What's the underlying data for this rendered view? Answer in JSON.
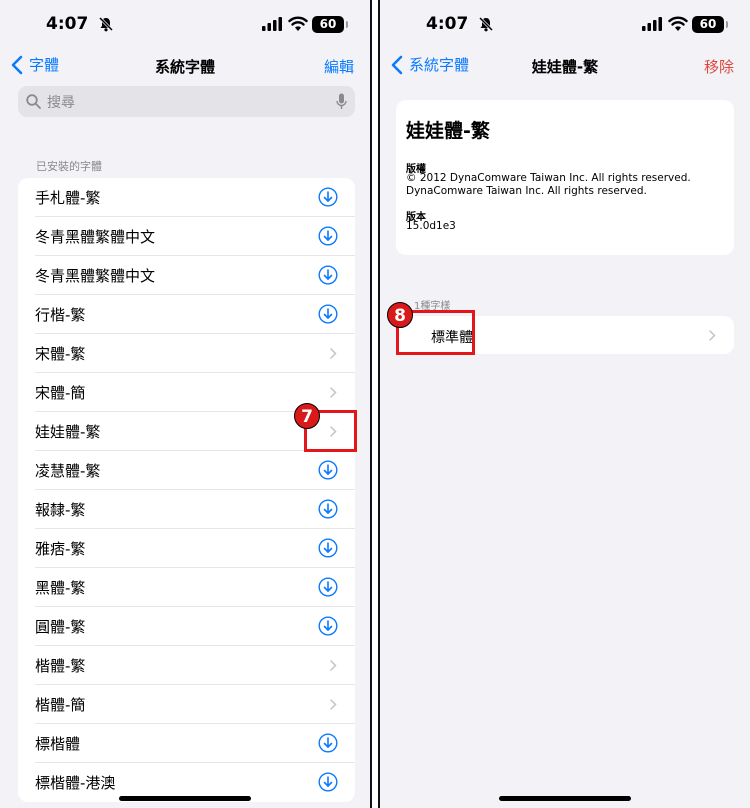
{
  "status": {
    "time": "4:07",
    "battery": "60"
  },
  "left": {
    "nav": {
      "back_label": "字體",
      "title": "系統字體",
      "action_label": "編輯"
    },
    "search": {
      "placeholder": "搜尋"
    },
    "section_header": "已安裝的字體",
    "fonts": [
      {
        "label": "手札體-繁",
        "action": "download"
      },
      {
        "label": "冬青黑體繁體中文",
        "action": "download"
      },
      {
        "label": "冬青黑體繁體中文",
        "action": "download"
      },
      {
        "label": "行楷-繁",
        "action": "download"
      },
      {
        "label": "宋體-繁",
        "action": "chevron"
      },
      {
        "label": "宋體-簡",
        "action": "chevron"
      },
      {
        "label": "娃娃體-繁",
        "action": "chevron"
      },
      {
        "label": "凌慧體-繁",
        "action": "download"
      },
      {
        "label": "報隸-繁",
        "action": "download"
      },
      {
        "label": "雅痞-繁",
        "action": "download"
      },
      {
        "label": "黑體-繁",
        "action": "download"
      },
      {
        "label": "圓體-繁",
        "action": "download"
      },
      {
        "label": "楷體-繁",
        "action": "chevron"
      },
      {
        "label": "楷體-簡",
        "action": "chevron"
      },
      {
        "label": "標楷體",
        "action": "download"
      },
      {
        "label": "標楷體-港澳",
        "action": "download"
      }
    ],
    "annotation_number": "7"
  },
  "right": {
    "nav": {
      "back_label": "系統字體",
      "title": "娃娃體-繁",
      "action_label": "移除"
    },
    "font_name": "娃娃體-繁",
    "copyright_label": "版權",
    "copyright_text": "© 2012 DynaComware Taiwan Inc. All rights reserved. DynaComware Taiwan Inc. All rights reserved.",
    "version_label": "版本",
    "version_value": "15.0d1e3",
    "styles_header": "1種字樣",
    "style_name": "標準體",
    "annotation_number": "8"
  },
  "colors": {
    "accent": "#0a7aff",
    "destructive": "#e0463c",
    "annotation": "#e4161a",
    "background": "#f2f2f7"
  }
}
